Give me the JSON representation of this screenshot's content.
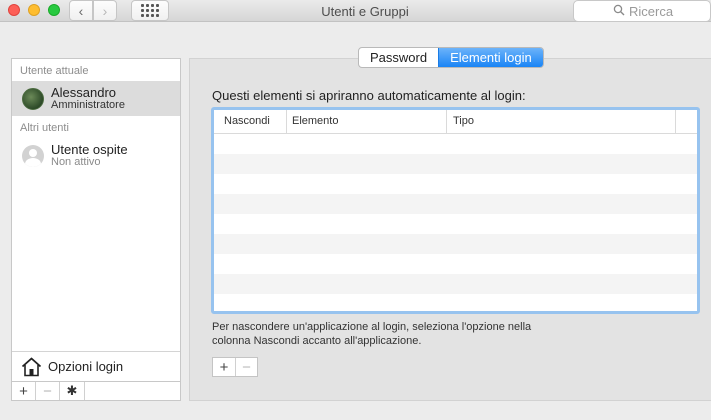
{
  "window": {
    "title": "Utenti e Gruppi",
    "nav_back": "‹",
    "nav_forward": "›",
    "search_placeholder": "Ricerca"
  },
  "sidebar": {
    "current_user_header": "Utente attuale",
    "current_user": {
      "name": "Alessandro",
      "role": "Amministratore"
    },
    "other_users_header": "Altri utenti",
    "other_users": [
      {
        "name": "Utente ospite",
        "status": "Non attivo"
      }
    ],
    "login_options_label": "Opzioni login",
    "tools": {
      "add": "+",
      "remove": "−",
      "gear": "✱"
    }
  },
  "main": {
    "tabs": [
      {
        "label": "Password",
        "active": false
      },
      {
        "label": "Elementi login",
        "active": true
      }
    ],
    "heading": "Questi elementi si apriranno automaticamente al login:",
    "table": {
      "columns": [
        "Nascondi",
        "Elemento",
        "Tipo"
      ],
      "rows": []
    },
    "hint": "Per nascondere un'applicazione al login, seleziona l'opzione nella colonna Nascondi accanto all'applicazione.",
    "tools": {
      "add": "+",
      "remove": "−"
    }
  },
  "colors": {
    "accent": "#1a84f5",
    "focus_ring": "#97c3ef",
    "close": "#fd5f57",
    "minimize": "#febd2f",
    "zoom": "#28c940"
  }
}
